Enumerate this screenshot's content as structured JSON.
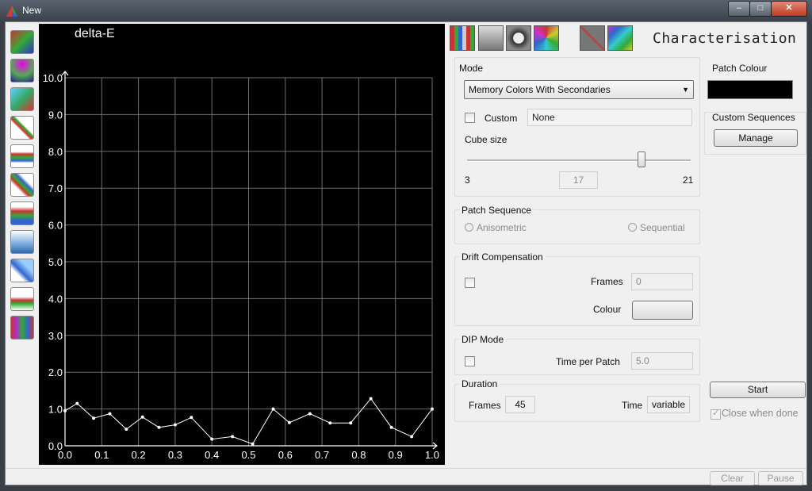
{
  "window": {
    "title": "New",
    "controls": [
      "minimize-icon",
      "maximize-icon",
      "close-icon"
    ]
  },
  "toolbar": {
    "tools": [
      "triangle-gamut-icon",
      "gamut-volume-icon",
      "cube-icon",
      "tone-curve-icon",
      "rgb-curves-icon",
      "gradient-icon",
      "rgb-balance-icon",
      "luminance-icon",
      "gamma-icon",
      "saturation-icon",
      "spectrum-icon"
    ]
  },
  "top_icons": [
    "calibration-patches-icon",
    "measure-probe-icon",
    "film-reel-icon",
    "color-wheel-icon",
    "crossed-tools-icon",
    "color-gradient-icon"
  ],
  "panel_title": "Characterisation",
  "mode": {
    "label": "Mode",
    "selected": "Memory Colors With Secondaries",
    "custom_label": "Custom",
    "custom_value": "None",
    "custom_checked": false,
    "cube_size_label": "Cube size",
    "cube_min": "3",
    "cube_max": "21",
    "cube_value": "17",
    "cube_fraction": 0.78
  },
  "patch_sequence": {
    "label": "Patch Sequence",
    "anisometric": "Anisometric",
    "sequential": "Sequential",
    "selected": "Anisometric"
  },
  "drift": {
    "label": "Drift Compensation",
    "frames_label": "Frames",
    "frames_value": "0",
    "colour_label": "Colour",
    "checked": false
  },
  "dip": {
    "label": "DIP Mode",
    "time_label": "Time per Patch",
    "time_value": "5.0",
    "checked": false
  },
  "duration": {
    "label": "Duration",
    "frames_label": "Frames",
    "frames_value": "45",
    "time_label": "Time",
    "time_value": "variable"
  },
  "patch_colour": {
    "label": "Patch Colour",
    "color": "#000000"
  },
  "custom_sequences": {
    "label": "Custom Sequences",
    "manage": "Manage"
  },
  "start_button": "Start",
  "close_when_done": {
    "label": "Close when done",
    "checked": true
  },
  "bottom": {
    "clear": "Clear",
    "pause": "Pause"
  },
  "chart_data": {
    "type": "line",
    "title": "delta-E",
    "xlim": [
      0.0,
      1.0
    ],
    "ylim": [
      0.0,
      10.0
    ],
    "x_ticks": [
      "0.0",
      "0.1",
      "0.2",
      "0.3",
      "0.4",
      "0.5",
      "0.6",
      "0.7",
      "0.8",
      "0.9",
      "1.0"
    ],
    "y_ticks": [
      "0.0",
      "1.0",
      "2.0",
      "3.0",
      "4.0",
      "5.0",
      "6.0",
      "7.0",
      "8.0",
      "9.0",
      "10.0"
    ],
    "grid": true,
    "background": "#000000",
    "line_color": "#ffffff",
    "series": [
      {
        "x": [
          0.0,
          0.033,
          0.078,
          0.122,
          0.167,
          0.211,
          0.256,
          0.3,
          0.344,
          0.4,
          0.456,
          0.511,
          0.567,
          0.611,
          0.667,
          0.722,
          0.778,
          0.833,
          0.889,
          0.944,
          1.0
        ],
        "y": [
          0.95,
          1.15,
          0.75,
          0.87,
          0.45,
          0.78,
          0.5,
          0.57,
          0.77,
          0.18,
          0.25,
          0.05,
          1.0,
          0.63,
          0.87,
          0.62,
          0.62,
          1.28,
          0.5,
          0.25,
          1.0
        ]
      }
    ]
  }
}
